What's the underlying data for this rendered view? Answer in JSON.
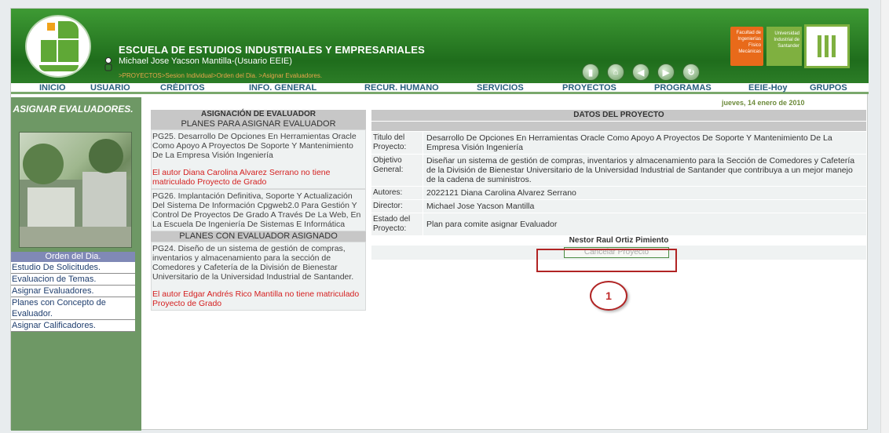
{
  "header": {
    "school": "ESCUELA DE ESTUDIOS INDUSTRIALES Y EMPRESARIALES",
    "user": "Michael Jose Yacson Mantilla-(Usuario EEIE)",
    "breadcrumb": ">PROYECTOS>Sesion Individual>Orden del Dia. >Asignar Evaluadores.",
    "logo_faculty": "Facultad de Ingenierías Físico Mecánicas",
    "logo_university": "Universidad Industrial de Santander"
  },
  "menu": [
    {
      "label": "INICIO"
    },
    {
      "label": "USUARIO"
    },
    {
      "label": "CRÉDITOS"
    },
    {
      "label": "INFO. GENERAL"
    },
    {
      "label": "RECUR. HUMANO"
    },
    {
      "label": "SERVICIOS"
    },
    {
      "label": "PROYECTOS"
    },
    {
      "label": "PROGRAMAS"
    },
    {
      "label": "EEIE-Hoy"
    },
    {
      "label": "GRUPOS"
    }
  ],
  "date": "jueves, 14 enero de 2010",
  "sidebar": {
    "title": "ASIGNAR EVALUADORES.",
    "menu_head": "Orden del Dia.",
    "items": [
      {
        "label": "Estudio De Solicitudes."
      },
      {
        "label": "Evaluacion de Temas."
      },
      {
        "label": "Asignar Evaluadores."
      },
      {
        "label": "Planes con Concepto de Evaluador."
      },
      {
        "label": "Asignar Calificadores."
      }
    ]
  },
  "panel_left": {
    "title": "ASIGNACIÓN DE EVALUADOR",
    "section1": "PLANES PARA ASIGNAR EVALUADOR",
    "plans_pending": [
      {
        "text": "PG25. Desarrollo De Opciones En Herramientas Oracle Como Apoyo A Proyectos De Soporte Y Mantenimiento De La Empresa Visión Ingeniería",
        "warning": "El autor Diana Carolina Alvarez Serrano no tiene matriculado Proyecto de Grado"
      },
      {
        "text": "PG26. Implantación Definitiva, Soporte Y Actualización Del Sistema De Información Cpgweb2.0 Para Gestión Y Control De Proyectos De Grado A Través De La Web, En La Escuela De Ingeniería De Sistemas E Informática",
        "warning": ""
      }
    ],
    "section2": "PLANES CON EVALUADOR ASIGNADO",
    "plans_assigned": [
      {
        "text": "PG24. Diseño de un sistema de gestión de compras, inventarios y almacenamiento para la sección de Comedores y Cafetería de la División de Bienestar Universitario de la Universidad Industrial de Santander.",
        "warning": "El autor Edgar Andrés Rico Mantilla no tiene matriculado Proyecto de Grado"
      }
    ]
  },
  "panel_right": {
    "title": "DATOS DEL PROYECTO",
    "rows": [
      {
        "key": "Titulo del Proyecto:",
        "value": "Desarrollo De Opciones En Herramientas Oracle Como Apoyo A Proyectos De Soporte Y Mantenimiento De La Empresa Visión Ingeniería"
      },
      {
        "key": "Objetivo General:",
        "value": "Diseñar un sistema de gestión de compras, inventarios y almacenamiento para la Sección de Comedores y Cafetería de la División de Bienestar Universitario de la Universidad Industrial de Santander que contribuya a un mejor manejo de la cadena de suministros."
      },
      {
        "key": "Autores:",
        "value": "2022121 Diana Carolina Alvarez Serrano"
      },
      {
        "key": "Director:",
        "value": "Michael Jose Yacson Mantilla"
      },
      {
        "key": "Estado del Proyecto:",
        "value": "Plan para comite asignar Evaluador"
      }
    ],
    "evaluator": "Nestor Raul Ortiz Pimiento",
    "cancel_button": "Cancelar Proyecto"
  },
  "annotation": "1"
}
